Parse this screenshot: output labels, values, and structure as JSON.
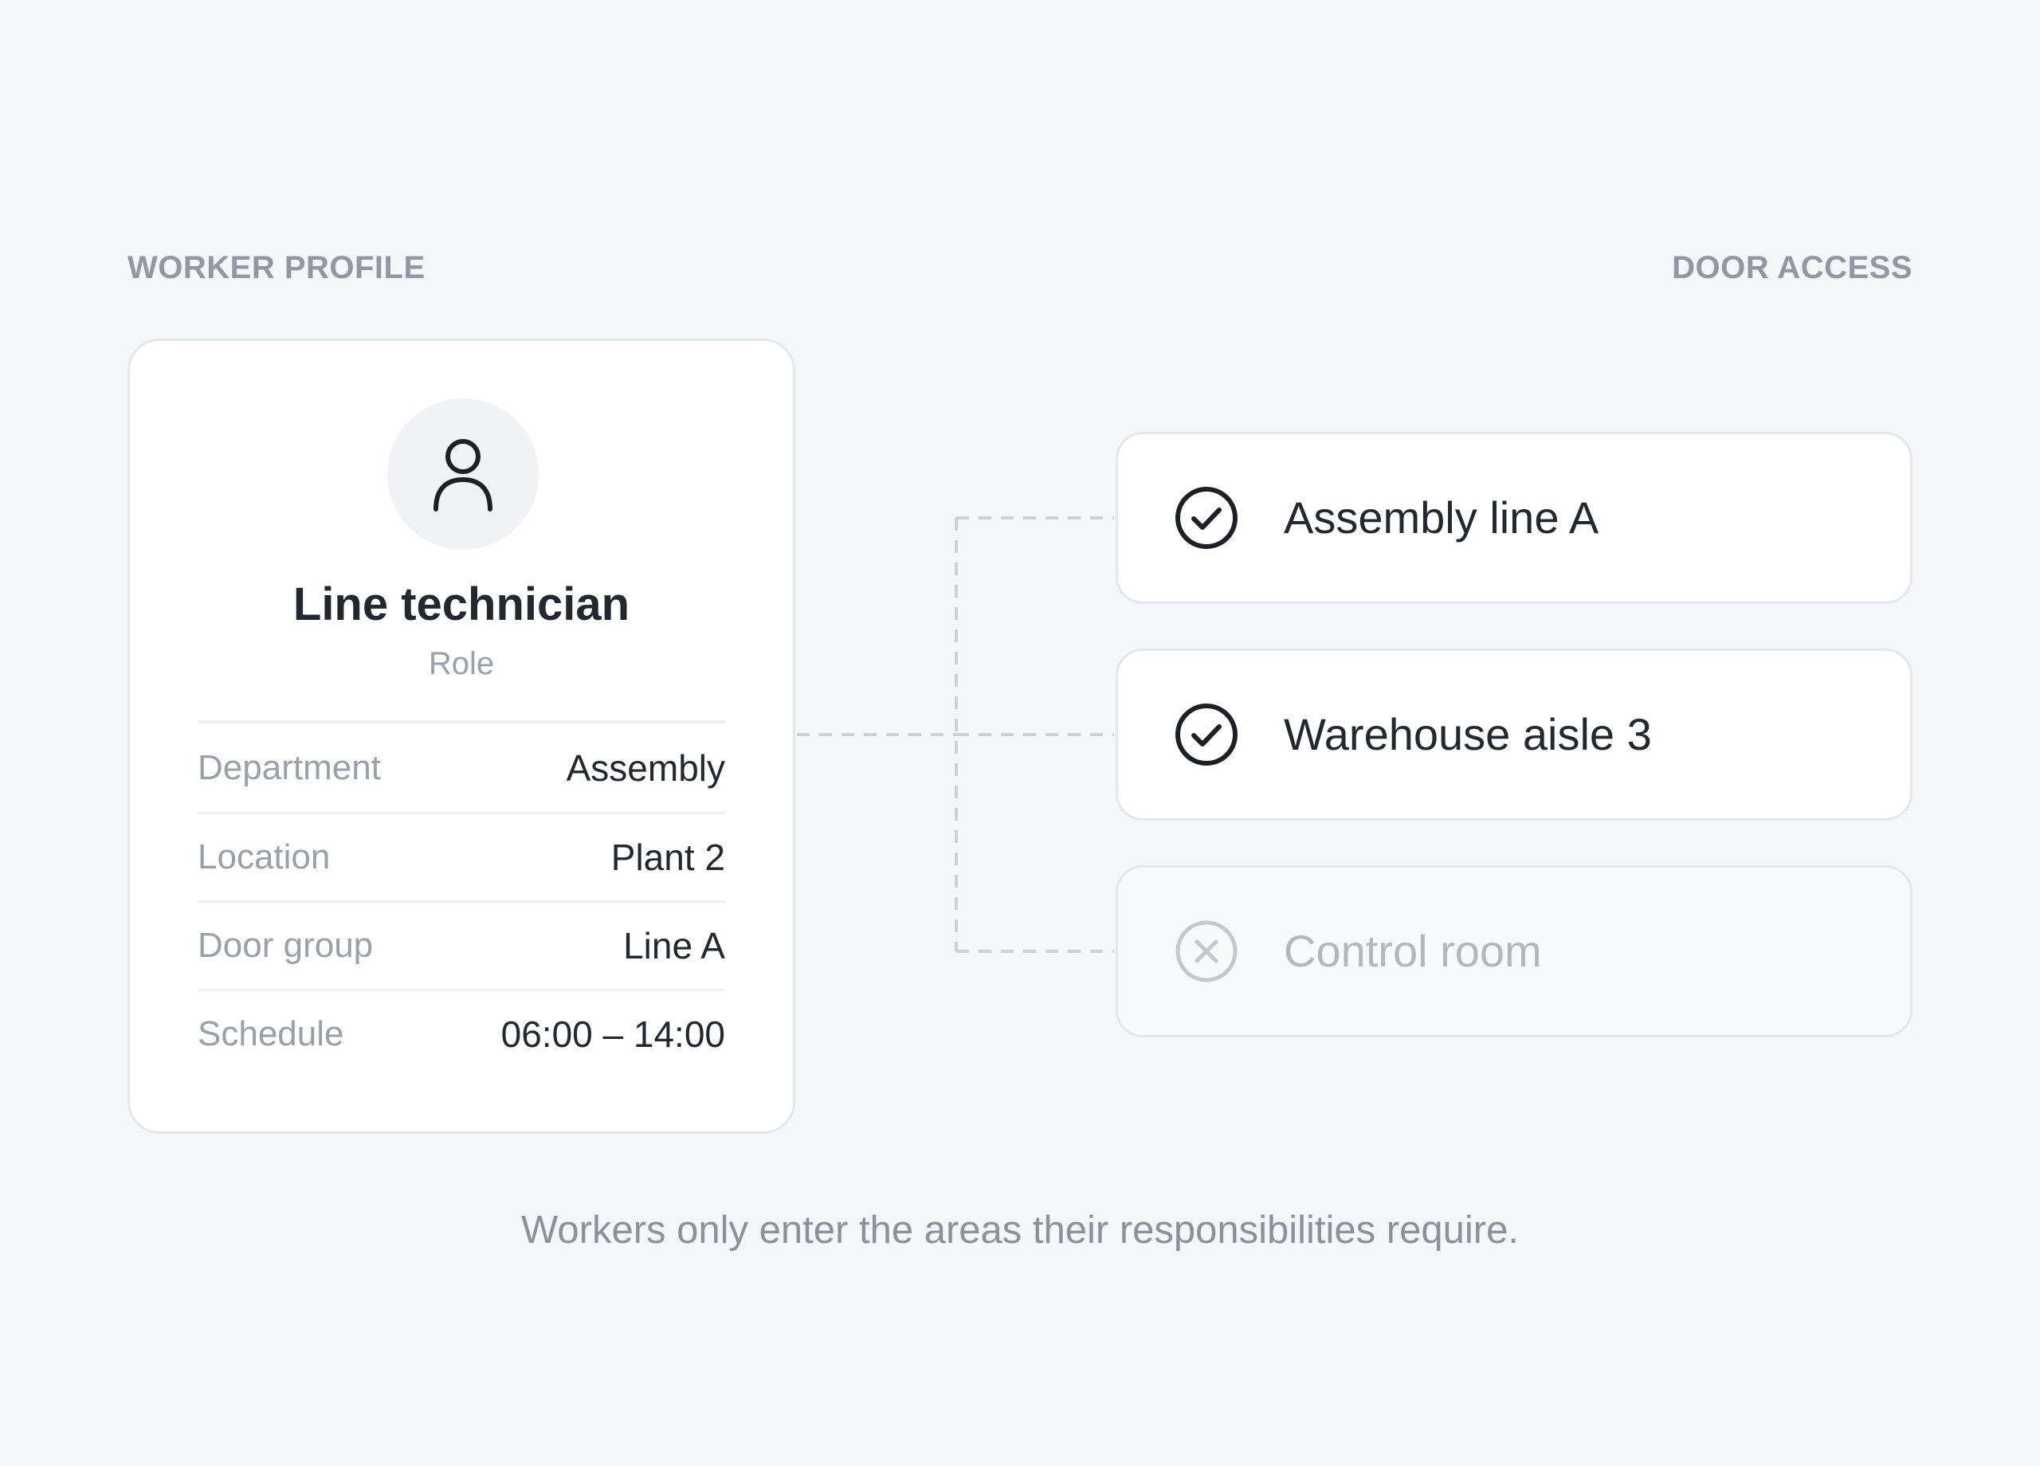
{
  "headings": {
    "profile": "WORKER PROFILE",
    "access": "DOOR ACCESS"
  },
  "profile": {
    "avatar_icon": "user-icon",
    "role_title": "Line technician",
    "role_label": "Role",
    "details": [
      {
        "key": "Department",
        "value": "Assembly"
      },
      {
        "key": "Location",
        "value": "Plant 2"
      },
      {
        "key": "Door group",
        "value": "Line A"
      },
      {
        "key": "Schedule",
        "value": "06:00 – 14:00"
      }
    ]
  },
  "access": {
    "doors": [
      {
        "label": "Assembly line A",
        "status": "granted",
        "icon": "check-circle-icon"
      },
      {
        "label": "Warehouse aisle 3",
        "status": "granted",
        "icon": "check-circle-icon"
      },
      {
        "label": "Control room",
        "status": "denied",
        "icon": "x-circle-icon"
      }
    ]
  },
  "caption": "Workers only enter the areas their responsibilities require.",
  "colors": {
    "background": "#f5f6f9",
    "granted": "#232830",
    "denied": "#b2b7be",
    "connector": "#cdd1d7"
  }
}
